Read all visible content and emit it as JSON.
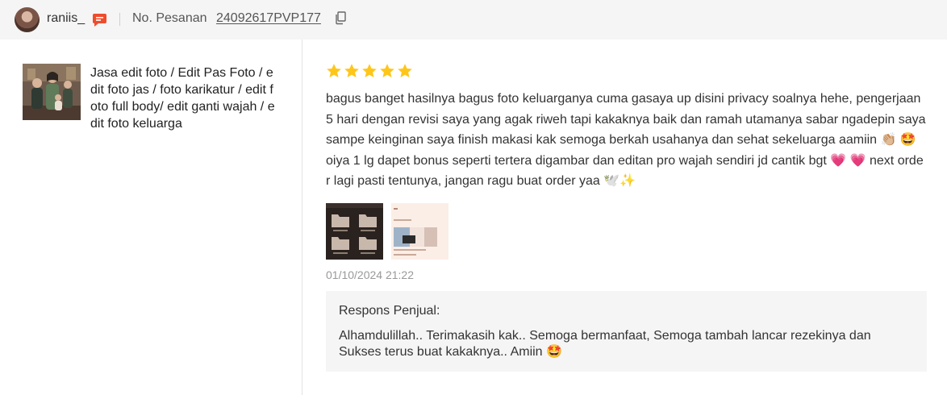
{
  "header": {
    "username": "raniis_",
    "order_label": "No. Pesanan",
    "order_number": "24092617PVP177"
  },
  "product": {
    "title": "Jasa edit foto / Edit Pas Foto / edit foto jas / foto karikatur / edit foto full body/ edit ganti wajah / edit foto keluarga"
  },
  "review": {
    "rating": 5,
    "text": "bagus banget hasilnya bagus foto keluarganya cuma gasaya up disini privacy soalnya hehe, pengerjaan 5 hari dengan revisi saya yang agak riweh tapi kakaknya baik dan ramah utamanya sabar ngadepin saya sampe keinginan saya finish makasi kak semoga berkah usahanya dan sehat sekeluarga aamiin 👏🏼 🤩 oiya 1 lg dapet bonus seperti tertera digambar dan editan pro wajah sendiri jd cantik bgt 💗 💗  next order lagi pasti tentunya, jangan ragu buat order yaa 🕊️✨",
    "timestamp": "01/10/2024 21:22"
  },
  "seller_response": {
    "label": "Respons Penjual:",
    "text": "Alhamdulillah.. Terimakasih kak.. Semoga bermanfaat, Semoga tambah lancar rezekinya dan Sukses terus buat kakaknya.. Amiin 🤩"
  },
  "colors": {
    "star": "#ffc61a",
    "chat_icon": "#ee4d2d",
    "header_bg": "#f5f5f5"
  }
}
